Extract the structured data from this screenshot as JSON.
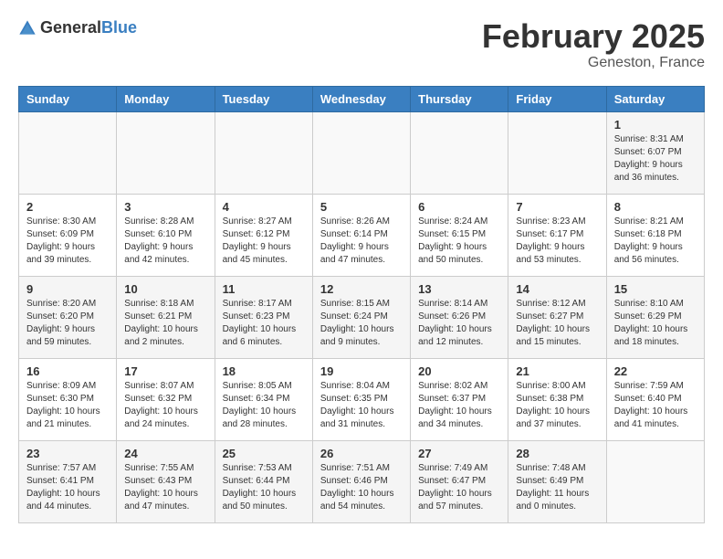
{
  "header": {
    "logo": {
      "general": "General",
      "blue": "Blue"
    },
    "title": "February 2025",
    "subtitle": "Geneston, France"
  },
  "weekdays": [
    "Sunday",
    "Monday",
    "Tuesday",
    "Wednesday",
    "Thursday",
    "Friday",
    "Saturday"
  ],
  "weeks": [
    [
      {
        "day": "",
        "info": ""
      },
      {
        "day": "",
        "info": ""
      },
      {
        "day": "",
        "info": ""
      },
      {
        "day": "",
        "info": ""
      },
      {
        "day": "",
        "info": ""
      },
      {
        "day": "",
        "info": ""
      },
      {
        "day": "1",
        "info": "Sunrise: 8:31 AM\nSunset: 6:07 PM\nDaylight: 9 hours and 36 minutes."
      }
    ],
    [
      {
        "day": "2",
        "info": "Sunrise: 8:30 AM\nSunset: 6:09 PM\nDaylight: 9 hours and 39 minutes."
      },
      {
        "day": "3",
        "info": "Sunrise: 8:28 AM\nSunset: 6:10 PM\nDaylight: 9 hours and 42 minutes."
      },
      {
        "day": "4",
        "info": "Sunrise: 8:27 AM\nSunset: 6:12 PM\nDaylight: 9 hours and 45 minutes."
      },
      {
        "day": "5",
        "info": "Sunrise: 8:26 AM\nSunset: 6:14 PM\nDaylight: 9 hours and 47 minutes."
      },
      {
        "day": "6",
        "info": "Sunrise: 8:24 AM\nSunset: 6:15 PM\nDaylight: 9 hours and 50 minutes."
      },
      {
        "day": "7",
        "info": "Sunrise: 8:23 AM\nSunset: 6:17 PM\nDaylight: 9 hours and 53 minutes."
      },
      {
        "day": "8",
        "info": "Sunrise: 8:21 AM\nSunset: 6:18 PM\nDaylight: 9 hours and 56 minutes."
      }
    ],
    [
      {
        "day": "9",
        "info": "Sunrise: 8:20 AM\nSunset: 6:20 PM\nDaylight: 9 hours and 59 minutes."
      },
      {
        "day": "10",
        "info": "Sunrise: 8:18 AM\nSunset: 6:21 PM\nDaylight: 10 hours and 2 minutes."
      },
      {
        "day": "11",
        "info": "Sunrise: 8:17 AM\nSunset: 6:23 PM\nDaylight: 10 hours and 6 minutes."
      },
      {
        "day": "12",
        "info": "Sunrise: 8:15 AM\nSunset: 6:24 PM\nDaylight: 10 hours and 9 minutes."
      },
      {
        "day": "13",
        "info": "Sunrise: 8:14 AM\nSunset: 6:26 PM\nDaylight: 10 hours and 12 minutes."
      },
      {
        "day": "14",
        "info": "Sunrise: 8:12 AM\nSunset: 6:27 PM\nDaylight: 10 hours and 15 minutes."
      },
      {
        "day": "15",
        "info": "Sunrise: 8:10 AM\nSunset: 6:29 PM\nDaylight: 10 hours and 18 minutes."
      }
    ],
    [
      {
        "day": "16",
        "info": "Sunrise: 8:09 AM\nSunset: 6:30 PM\nDaylight: 10 hours and 21 minutes."
      },
      {
        "day": "17",
        "info": "Sunrise: 8:07 AM\nSunset: 6:32 PM\nDaylight: 10 hours and 24 minutes."
      },
      {
        "day": "18",
        "info": "Sunrise: 8:05 AM\nSunset: 6:34 PM\nDaylight: 10 hours and 28 minutes."
      },
      {
        "day": "19",
        "info": "Sunrise: 8:04 AM\nSunset: 6:35 PM\nDaylight: 10 hours and 31 minutes."
      },
      {
        "day": "20",
        "info": "Sunrise: 8:02 AM\nSunset: 6:37 PM\nDaylight: 10 hours and 34 minutes."
      },
      {
        "day": "21",
        "info": "Sunrise: 8:00 AM\nSunset: 6:38 PM\nDaylight: 10 hours and 37 minutes."
      },
      {
        "day": "22",
        "info": "Sunrise: 7:59 AM\nSunset: 6:40 PM\nDaylight: 10 hours and 41 minutes."
      }
    ],
    [
      {
        "day": "23",
        "info": "Sunrise: 7:57 AM\nSunset: 6:41 PM\nDaylight: 10 hours and 44 minutes."
      },
      {
        "day": "24",
        "info": "Sunrise: 7:55 AM\nSunset: 6:43 PM\nDaylight: 10 hours and 47 minutes."
      },
      {
        "day": "25",
        "info": "Sunrise: 7:53 AM\nSunset: 6:44 PM\nDaylight: 10 hours and 50 minutes."
      },
      {
        "day": "26",
        "info": "Sunrise: 7:51 AM\nSunset: 6:46 PM\nDaylight: 10 hours and 54 minutes."
      },
      {
        "day": "27",
        "info": "Sunrise: 7:49 AM\nSunset: 6:47 PM\nDaylight: 10 hours and 57 minutes."
      },
      {
        "day": "28",
        "info": "Sunrise: 7:48 AM\nSunset: 6:49 PM\nDaylight: 11 hours and 0 minutes."
      },
      {
        "day": "",
        "info": ""
      }
    ]
  ]
}
